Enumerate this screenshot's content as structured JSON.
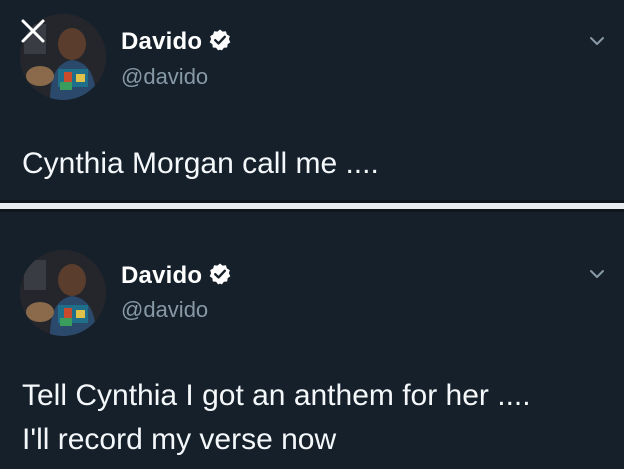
{
  "tweets": [
    {
      "author_name": "Davido",
      "handle": "@davido",
      "verified": true,
      "text_lines": [
        "Cynthia Morgan call me ...."
      ],
      "icons": {
        "close": "close-icon",
        "verified": "verified-badge-icon",
        "menu": "chevron-down-icon"
      }
    },
    {
      "author_name": "Davido",
      "handle": "@davido",
      "verified": true,
      "text_lines": [
        "Tell Cynthia I got an anthem for her ....",
        "I'll record my verse now"
      ],
      "icons": {
        "verified": "verified-badge-icon",
        "menu": "chevron-down-icon"
      }
    }
  ],
  "colors": {
    "background": "#15202b",
    "text": "#f5f8fa",
    "secondary_text": "#8899a6",
    "separator": "#e9ecef"
  }
}
